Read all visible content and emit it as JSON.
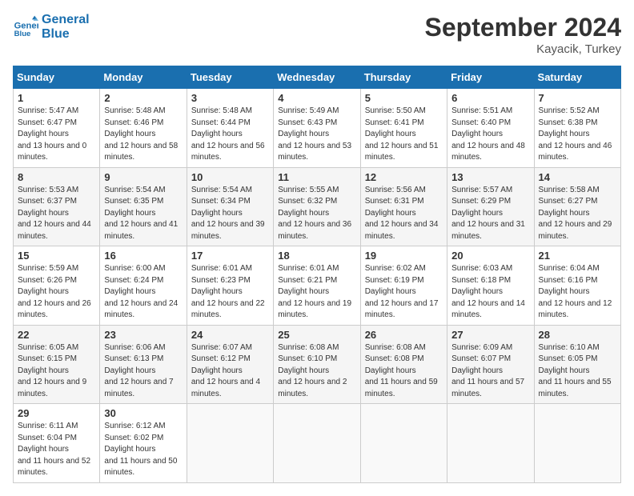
{
  "header": {
    "logo_line1": "General",
    "logo_line2": "Blue",
    "month": "September 2024",
    "location": "Kayacik, Turkey"
  },
  "weekdays": [
    "Sunday",
    "Monday",
    "Tuesday",
    "Wednesday",
    "Thursday",
    "Friday",
    "Saturday"
  ],
  "weeks": [
    [
      {
        "day": 1,
        "rise": "5:47 AM",
        "set": "6:47 PM",
        "daylight": "13 hours and 0 minutes."
      },
      {
        "day": 2,
        "rise": "5:48 AM",
        "set": "6:46 PM",
        "daylight": "12 hours and 58 minutes."
      },
      {
        "day": 3,
        "rise": "5:48 AM",
        "set": "6:44 PM",
        "daylight": "12 hours and 56 minutes."
      },
      {
        "day": 4,
        "rise": "5:49 AM",
        "set": "6:43 PM",
        "daylight": "12 hours and 53 minutes."
      },
      {
        "day": 5,
        "rise": "5:50 AM",
        "set": "6:41 PM",
        "daylight": "12 hours and 51 minutes."
      },
      {
        "day": 6,
        "rise": "5:51 AM",
        "set": "6:40 PM",
        "daylight": "12 hours and 48 minutes."
      },
      {
        "day": 7,
        "rise": "5:52 AM",
        "set": "6:38 PM",
        "daylight": "12 hours and 46 minutes."
      }
    ],
    [
      {
        "day": 8,
        "rise": "5:53 AM",
        "set": "6:37 PM",
        "daylight": "12 hours and 44 minutes."
      },
      {
        "day": 9,
        "rise": "5:54 AM",
        "set": "6:35 PM",
        "daylight": "12 hours and 41 minutes."
      },
      {
        "day": 10,
        "rise": "5:54 AM",
        "set": "6:34 PM",
        "daylight": "12 hours and 39 minutes."
      },
      {
        "day": 11,
        "rise": "5:55 AM",
        "set": "6:32 PM",
        "daylight": "12 hours and 36 minutes."
      },
      {
        "day": 12,
        "rise": "5:56 AM",
        "set": "6:31 PM",
        "daylight": "12 hours and 34 minutes."
      },
      {
        "day": 13,
        "rise": "5:57 AM",
        "set": "6:29 PM",
        "daylight": "12 hours and 31 minutes."
      },
      {
        "day": 14,
        "rise": "5:58 AM",
        "set": "6:27 PM",
        "daylight": "12 hours and 29 minutes."
      }
    ],
    [
      {
        "day": 15,
        "rise": "5:59 AM",
        "set": "6:26 PM",
        "daylight": "12 hours and 26 minutes."
      },
      {
        "day": 16,
        "rise": "6:00 AM",
        "set": "6:24 PM",
        "daylight": "12 hours and 24 minutes."
      },
      {
        "day": 17,
        "rise": "6:01 AM",
        "set": "6:23 PM",
        "daylight": "12 hours and 22 minutes."
      },
      {
        "day": 18,
        "rise": "6:01 AM",
        "set": "6:21 PM",
        "daylight": "12 hours and 19 minutes."
      },
      {
        "day": 19,
        "rise": "6:02 AM",
        "set": "6:19 PM",
        "daylight": "12 hours and 17 minutes."
      },
      {
        "day": 20,
        "rise": "6:03 AM",
        "set": "6:18 PM",
        "daylight": "12 hours and 14 minutes."
      },
      {
        "day": 21,
        "rise": "6:04 AM",
        "set": "6:16 PM",
        "daylight": "12 hours and 12 minutes."
      }
    ],
    [
      {
        "day": 22,
        "rise": "6:05 AM",
        "set": "6:15 PM",
        "daylight": "12 hours and 9 minutes."
      },
      {
        "day": 23,
        "rise": "6:06 AM",
        "set": "6:13 PM",
        "daylight": "12 hours and 7 minutes."
      },
      {
        "day": 24,
        "rise": "6:07 AM",
        "set": "6:12 PM",
        "daylight": "12 hours and 4 minutes."
      },
      {
        "day": 25,
        "rise": "6:08 AM",
        "set": "6:10 PM",
        "daylight": "12 hours and 2 minutes."
      },
      {
        "day": 26,
        "rise": "6:08 AM",
        "set": "6:08 PM",
        "daylight": "11 hours and 59 minutes."
      },
      {
        "day": 27,
        "rise": "6:09 AM",
        "set": "6:07 PM",
        "daylight": "11 hours and 57 minutes."
      },
      {
        "day": 28,
        "rise": "6:10 AM",
        "set": "6:05 PM",
        "daylight": "11 hours and 55 minutes."
      }
    ],
    [
      {
        "day": 29,
        "rise": "6:11 AM",
        "set": "6:04 PM",
        "daylight": "11 hours and 52 minutes."
      },
      {
        "day": 30,
        "rise": "6:12 AM",
        "set": "6:02 PM",
        "daylight": "11 hours and 50 minutes."
      },
      null,
      null,
      null,
      null,
      null
    ]
  ]
}
